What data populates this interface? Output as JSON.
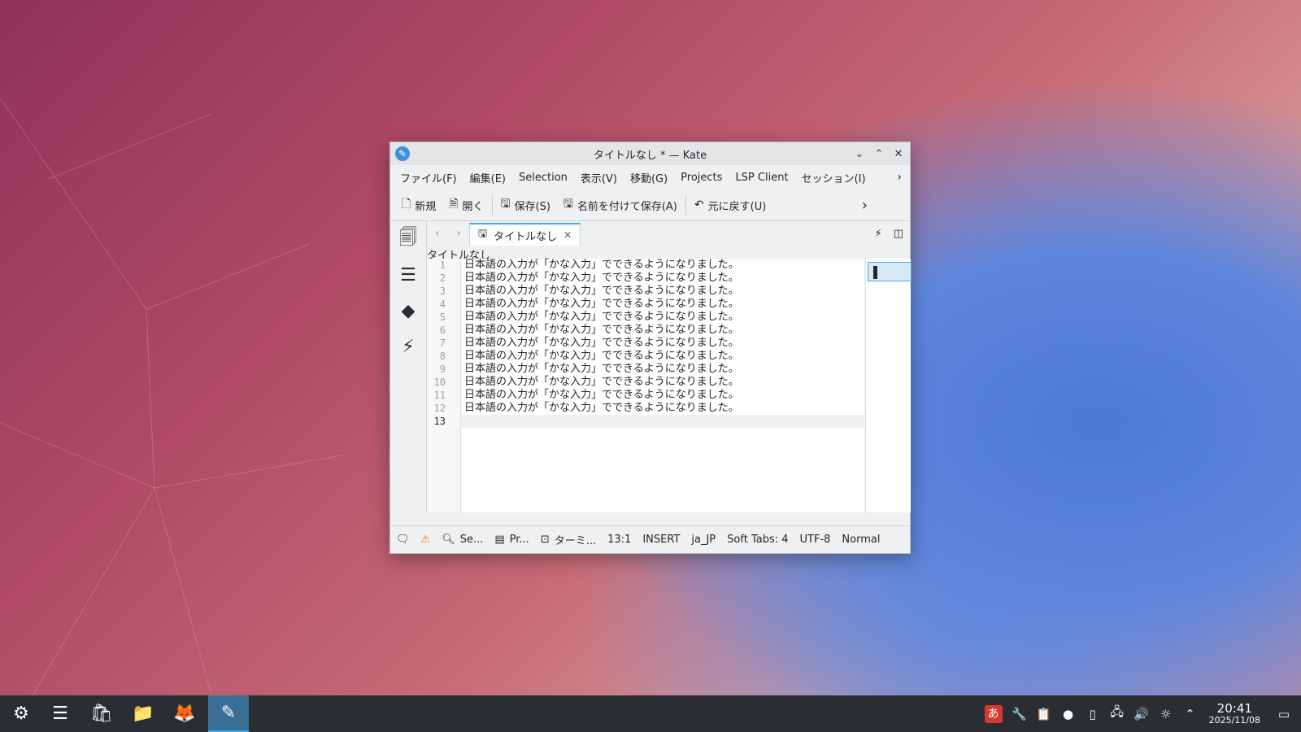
{
  "window": {
    "title": "タイトルなし * — Kate"
  },
  "menu": [
    "ファイル(F)",
    "編集(E)",
    "Selection",
    "表示(V)",
    "移動(G)",
    "Projects",
    "LSP Client",
    "セッション(I)"
  ],
  "toolbar": {
    "new": "新規",
    "open": "開く",
    "save": "保存(S)",
    "save_as": "名前を付けて保存(A)",
    "undo": "元に戻す(U)"
  },
  "tab": {
    "label": "タイトルなし"
  },
  "breadcrumb": "タイトルなし",
  "editor": {
    "line_numbers": [
      "1",
      "2",
      "3",
      "4",
      "5",
      "6",
      "7",
      "8",
      "9",
      "10",
      "11",
      "12",
      "13"
    ],
    "lines": [
      "日本語の入力が「かな入力」でできるようになりました。",
      "日本語の入力が「かな入力」でできるようになりました。",
      "日本語の入力が「かな入力」でできるようになりました。",
      "日本語の入力が「かな入力」でできるようになりました。",
      "日本語の入力が「かな入力」でできるようになりました。",
      "日本語の入力が「かな入力」でできるようになりました。",
      "日本語の入力が「かな入力」でできるようになりました。",
      "日本語の入力が「かな入力」でできるようになりました。",
      "日本語の入力が「かな入力」でできるようになりました。",
      "日本語の入力が「かな入力」でできるようになりました。",
      "日本語の入力が「かな入力」でできるようになりました。",
      "日本語の入力が「かな入力」でできるようになりました。",
      ""
    ]
  },
  "status": {
    "search": "Se...",
    "projects": "Pr...",
    "terminal": "ターミ...",
    "position": "13:1",
    "mode": "INSERT",
    "dictionary": "ja_JP",
    "indent": "Soft Tabs: 4",
    "encoding": "UTF-8",
    "input_mode": "Normal"
  },
  "taskbar": {
    "time": "20:41",
    "date": "2025/11/08",
    "ime": "あ"
  },
  "colors": {
    "accent": "#3daee9",
    "taskbar": "#2a2e32",
    "warning": "#f67400"
  }
}
